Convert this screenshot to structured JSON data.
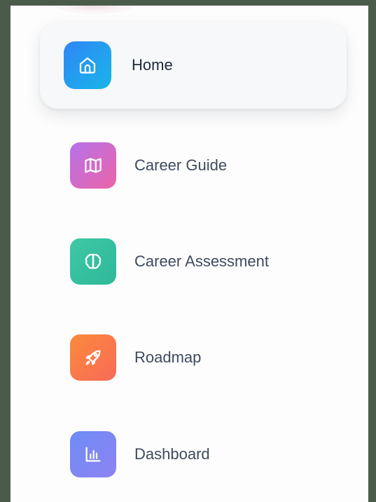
{
  "nav": {
    "items": [
      {
        "label": "Home",
        "icon": "home-icon",
        "color_from": "#2f86f6",
        "color_to": "#18b6e8",
        "active": true
      },
      {
        "label": "Career Guide",
        "icon": "map-icon",
        "color_from": "#b672ea",
        "color_to": "#ec64a8",
        "active": false
      },
      {
        "label": "Career Assessment",
        "icon": "brain-icon",
        "color_from": "#3fc8a5",
        "color_to": "#2fb89a",
        "active": false
      },
      {
        "label": "Roadmap",
        "icon": "rocket-icon",
        "color_from": "#fb8a3c",
        "color_to": "#f86a58",
        "active": false
      },
      {
        "label": "Dashboard",
        "icon": "bar-chart-icon",
        "color_from": "#6f8cf6",
        "color_to": "#8c83f2",
        "active": false
      }
    ]
  }
}
